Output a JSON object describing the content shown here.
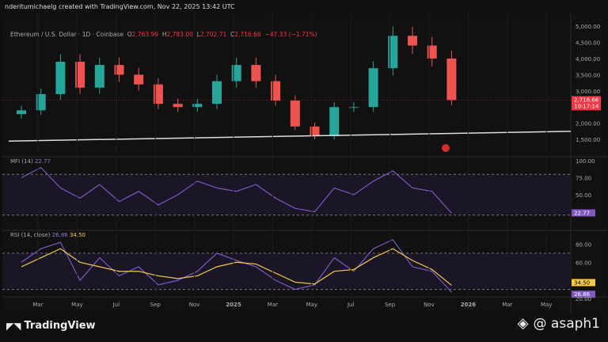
{
  "credit": "nderitumichaelg created with TradingView.com, Nov 22, 2025 13:42 UTC",
  "legend": {
    "symbol": "Ethereum / U.S. Dollar · 1D · Coinbase",
    "o_label": "O",
    "o": "2,763.99",
    "h_label": "H",
    "h": "2,783.00",
    "l_label": "L",
    "l": "2,702.71",
    "c_label": "C",
    "c": "2,716.66",
    "change": "−47.33 (−1.71%)"
  },
  "price_tag": {
    "price": "2,716.66",
    "countdown": "10:17:14"
  },
  "mfi": {
    "label": "MFI (14)",
    "value": "22.77"
  },
  "rsi": {
    "label": "RSI (14, close)",
    "value": "26.86",
    "ma": "34.50"
  },
  "brand": "TradingView",
  "watermark": "@ asaph1",
  "colors": {
    "up": "#26a69a",
    "down": "#ef5350",
    "mfi": "#7e57c2",
    "rsi_ma": "#f7c948",
    "tag": "#f23645"
  },
  "chart_data": [
    {
      "type": "candlestick",
      "title": "Ethereum / U.S. Dollar · 1D · Coinbase",
      "ylim": [
        1200,
        5200
      ],
      "yticks": [
        5000,
        4500,
        4000,
        3500,
        3000,
        2000,
        1500
      ],
      "ytick_labels": [
        "5,000.00",
        "4,500.00",
        "4,000.00",
        "3,500.00",
        "3,000.00",
        "2,000.00",
        "1,500.00"
      ],
      "xtick_labels": [
        "Mar",
        "May",
        "Jul",
        "Sep",
        "Nov",
        "2025",
        "Mar",
        "May",
        "Jul",
        "Sep",
        "Nov",
        "2026",
        "Mar",
        "May"
      ],
      "x_months": [
        "2024-01",
        "2024-02",
        "2024-03",
        "2024-04",
        "2024-05",
        "2024-06",
        "2024-07",
        "2024-08",
        "2024-09",
        "2024-10",
        "2024-11",
        "2024-12",
        "2025-01",
        "2025-02",
        "2025-03",
        "2025-04",
        "2025-05",
        "2025-06",
        "2025-07",
        "2025-08",
        "2025-09",
        "2025-10",
        "2025-11"
      ],
      "close": [
        2400,
        2900,
        3900,
        3100,
        3800,
        3500,
        3200,
        2600,
        2500,
        2600,
        3300,
        3800,
        3300,
        2700,
        1900,
        1600,
        2500,
        2500,
        3700,
        4700,
        4400,
        4000,
        2717
      ],
      "trendline": [
        [
          0,
          1450
        ],
        [
          22.5,
          1750
        ]
      ]
    },
    {
      "type": "line",
      "title": "MFI (14)",
      "ylim": [
        0,
        100
      ],
      "yticks": [
        100,
        75,
        50
      ],
      "ytick_labels": [
        "100.00",
        "75.00",
        "50.00"
      ],
      "band": [
        20,
        80
      ],
      "values": [
        75,
        90,
        60,
        45,
        65,
        40,
        55,
        35,
        50,
        70,
        60,
        55,
        65,
        45,
        30,
        25,
        60,
        50,
        70,
        85,
        60,
        55,
        23
      ]
    },
    {
      "type": "line",
      "title": "RSI (14, close)",
      "ylim": [
        20,
        90
      ],
      "yticks": [
        80,
        60
      ],
      "ytick_labels": [
        "80.00",
        "60.00",
        "20.00"
      ],
      "band": [
        30,
        70
      ],
      "values": [
        60,
        75,
        82,
        40,
        65,
        45,
        55,
        35,
        40,
        50,
        70,
        62,
        55,
        40,
        30,
        35,
        65,
        50,
        75,
        85,
        55,
        50,
        27
      ],
      "ma": [
        55,
        65,
        75,
        60,
        55,
        50,
        50,
        45,
        42,
        45,
        55,
        60,
        58,
        48,
        38,
        36,
        50,
        52,
        65,
        75,
        62,
        52,
        34.5
      ]
    }
  ]
}
